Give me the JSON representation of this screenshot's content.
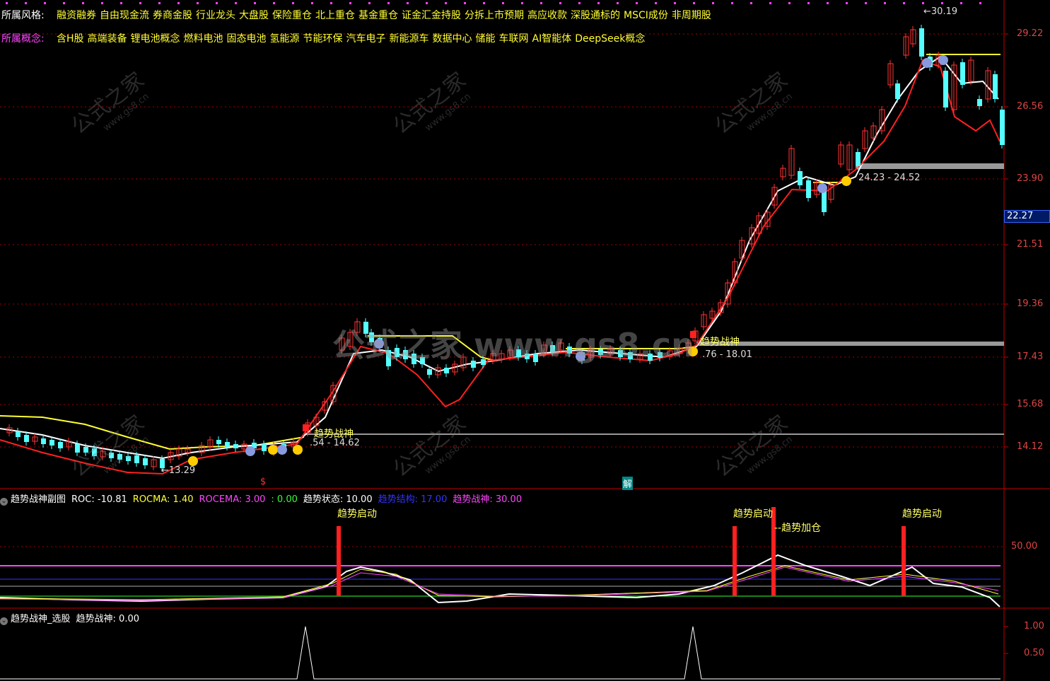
{
  "header": {
    "style_label": "所属风格:",
    "style_items": [
      "融资融券",
      "自由现金流",
      "券商金股",
      "行业龙头",
      "大盘股",
      "保险重仓",
      "北上重仓",
      "基金重仓",
      "证金汇金持股",
      "分拆上市预期",
      "高应收款",
      "深股通标的",
      "MSCI成份",
      "非周期股"
    ],
    "concept_label": "所属概念:",
    "concept_items": [
      "含H股",
      "高端装备",
      "锂电池概念",
      "燃料电池",
      "固态电池",
      "氢能源",
      "节能环保",
      "汽车电子",
      "新能源车",
      "数据中心",
      "储能",
      "车联网",
      "AI智能体",
      "DeepSeek概念"
    ]
  },
  "colors": {
    "bg": "#000000",
    "up": "#ff3333",
    "down": "#54ffff",
    "ma_red": "#ff2020",
    "ma_white": "#ffffff",
    "ma_yellow": "#ffff33",
    "label_yellow": "#ffff66",
    "magenta": "#ff44ff",
    "blue": "#3333ff",
    "green": "#33ff33",
    "axis": "#c00000",
    "grid": "#a00000"
  },
  "watermark": {
    "cn": "公式之家",
    "url": "www.gs8.cn",
    "big": "公式之家 www.gs8.cn"
  },
  "main_chart": {
    "price_axis": [
      "29.22",
      "26.56",
      "23.90",
      "21.51",
      "19.36",
      "17.43",
      "15.68",
      "14.12"
    ],
    "current_price": "22.27",
    "high_label": "30.19",
    "low_label": "13.29",
    "signal_label": "趋势战神",
    "range_labels": [
      "24.23 - 24.52",
      ".76 - 18.01",
      ".54 - 14.62"
    ],
    "bottom_marks": [
      "$",
      "解"
    ]
  },
  "sub_chart1": {
    "title": "趋势战神副图",
    "items": [
      {
        "k": "ROC:",
        "v": "-10.81",
        "c": "#ffffff"
      },
      {
        "k": "ROCMA:",
        "v": "1.40",
        "c": "#ffff33"
      },
      {
        "k": "ROCEMA:",
        "v": "3.00",
        "c": "#ff44ff"
      },
      {
        "k": ":",
        "v": "0.00",
        "c": "#33ff33"
      },
      {
        "k": "趋势状态:",
        "v": "10.00",
        "c": "#ffffff"
      },
      {
        "k": "趋势结构:",
        "v": "17.00",
        "c": "#3333ff"
      },
      {
        "k": "趋势战神:",
        "v": "30.00",
        "c": "#ff44ff"
      }
    ],
    "axis_value": "50.00",
    "annotations": [
      "趋势启动",
      "趋势启动",
      "--趋势加仓",
      "趋势启动"
    ]
  },
  "sub_chart2": {
    "title": "趋势战神_选股",
    "item_key": "趋势战神:",
    "item_value": "0.00",
    "axis_values": [
      "1.00",
      "0.50"
    ]
  }
}
